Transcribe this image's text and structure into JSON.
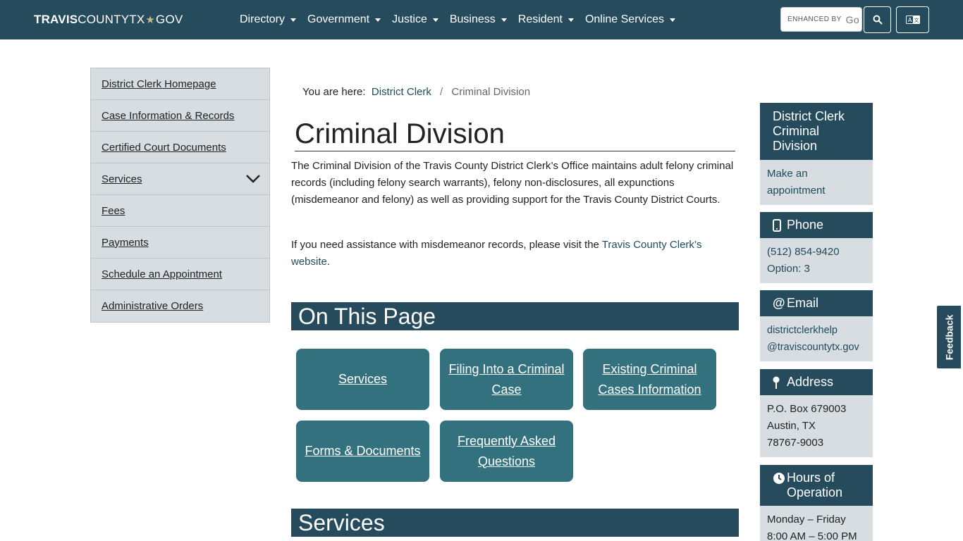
{
  "header": {
    "logo_bold": "TRAVIS",
    "logo_rest": "COUNTYTX",
    "logo_star": "★",
    "logo_tld": "GOV",
    "nav": [
      "Directory",
      "Government",
      "Justice",
      "Business",
      "Resident",
      "Online Services"
    ],
    "search_label": "ENHANCED BY",
    "search_brand": "Go",
    "icons": {
      "search": "search-icon",
      "translate": "translate-icon"
    }
  },
  "sidebar": {
    "items": [
      {
        "label": "District Clerk Homepage"
      },
      {
        "label": "Case Information & Records"
      },
      {
        "label": "Certified Court Documents"
      },
      {
        "label": "Services"
      },
      {
        "label": "Fees"
      },
      {
        "label": "Payments"
      },
      {
        "label": "Schedule an Appointment"
      },
      {
        "label": "Administrative Orders"
      }
    ]
  },
  "breadcrumb": {
    "prefix": "You are here:",
    "link": "District Clerk",
    "separator": "/",
    "current": "Criminal Division"
  },
  "main": {
    "title": "Criminal Division",
    "intro": "The Criminal Division of the Travis County District Clerk’s Office maintains adult felony criminal records (including felony search warrants), felony non-disclosures, all expunctions (misdemeanor and felony) as well as providing support for the Travis County District Courts.",
    "intro2_pre": "If you need assistance with misdemeanor records, please visit the ",
    "intro2_link": "Travis County Clerk’s website",
    "intro2_post": ".",
    "on_this_page": "On This Page",
    "tiles": [
      {
        "label": "Services"
      },
      {
        "label": "Filing Into a Criminal Case"
      },
      {
        "label": "Existing Criminal Cases Information"
      },
      {
        "label": "Forms & Documents"
      },
      {
        "label": "Frequently Asked Questions"
      }
    ],
    "services_heading": "Services"
  },
  "info": {
    "title": "District Clerk Criminal Division",
    "appointment": "Make an appointment",
    "phone_label": "Phone",
    "phone_number": "(512) 854-9420",
    "phone_option": "Option: 3",
    "email_label": "Email",
    "email_1": "districtclerkhelp",
    "email_2": "@traviscountytx.gov",
    "address_label": "Address",
    "address_1": "P.O. Box 679003",
    "address_2": "Austin, TX",
    "address_3": "78767-9003",
    "hours_label": "Hours of Operation",
    "hours_days": "Monday – Friday",
    "hours_time": "8:00 AM – 5:00 PM"
  },
  "feedback": "Feedback",
  "colors": {
    "header": "#254b5c",
    "tile": "#34717f",
    "sidebar": "#d7dde0"
  }
}
